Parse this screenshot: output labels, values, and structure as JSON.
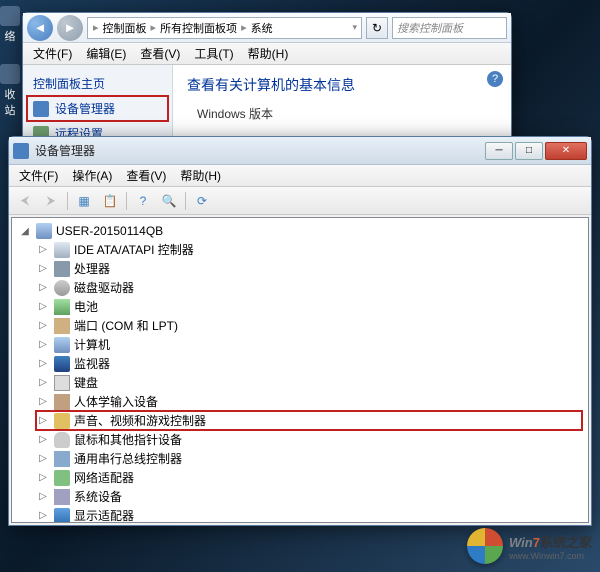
{
  "desktop": {
    "icons": [
      "络",
      "收站"
    ]
  },
  "cp": {
    "breadcrumb": {
      "seg1": "控制面板",
      "seg2": "所有控制面板项",
      "seg3": "系统"
    },
    "search_placeholder": "搜索控制面板",
    "menu": {
      "file": "文件(F)",
      "edit": "编辑(E)",
      "view": "查看(V)",
      "tools": "工具(T)",
      "help": "帮助(H)"
    },
    "side": {
      "home": "控制面板主页",
      "devmgr": "设备管理器",
      "remote": "远程设置"
    },
    "main": {
      "heading": "查看有关计算机的基本信息",
      "subheading": "Windows 版本"
    }
  },
  "dm": {
    "title": "设备管理器",
    "menu": {
      "file": "文件(F)",
      "action": "操作(A)",
      "view": "查看(V)",
      "help": "帮助(H)"
    },
    "root": "USER-20150114QB",
    "nodes": [
      {
        "label": "IDE ATA/ATAPI 控制器",
        "icon": "ico-device"
      },
      {
        "label": "处理器",
        "icon": "ico-chip"
      },
      {
        "label": "磁盘驱动器",
        "icon": "ico-disk"
      },
      {
        "label": "电池",
        "icon": "ico-battery"
      },
      {
        "label": "端口 (COM 和 LPT)",
        "icon": "ico-port"
      },
      {
        "label": "计算机",
        "icon": "ico-computer"
      },
      {
        "label": "监视器",
        "icon": "ico-monitor"
      },
      {
        "label": "键盘",
        "icon": "ico-kbd"
      },
      {
        "label": "人体学输入设备",
        "icon": "ico-hid"
      },
      {
        "label": "声音、视频和游戏控制器",
        "icon": "ico-sound",
        "highlight": true
      },
      {
        "label": "鼠标和其他指针设备",
        "icon": "ico-mouse"
      },
      {
        "label": "通用串行总线控制器",
        "icon": "ico-usb"
      },
      {
        "label": "网络适配器",
        "icon": "ico-net"
      },
      {
        "label": "系统设备",
        "icon": "ico-sys"
      },
      {
        "label": "显示适配器",
        "icon": "ico-display"
      }
    ]
  },
  "watermark": {
    "brand_prefix": "Win",
    "brand_num": "7",
    "brand_suffix": "系统之家",
    "url": "www.Winwin7.com"
  }
}
